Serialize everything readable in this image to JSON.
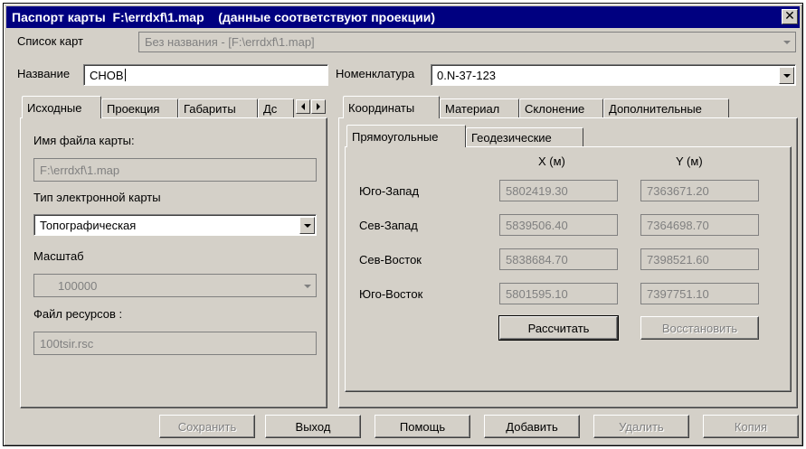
{
  "window": {
    "title": "Паспорт карты  F:\\errdxf\\1.map    (данные соответствуют проекции)",
    "close_glyph": "✕"
  },
  "map_list": {
    "label": "Список карт",
    "value": "Без названия  - [F:\\errdxf\\1.map]"
  },
  "name": {
    "label": "Название",
    "value": "СНОВ"
  },
  "nomenclature": {
    "label": "Номенклатура",
    "value": "0.N-37-123"
  },
  "left_tabs": {
    "items": [
      "Исходные",
      "Проекция",
      "Габариты",
      "Дс"
    ],
    "active": 0
  },
  "source": {
    "filename_label": "Имя файла карты:",
    "filename_value": "F:\\errdxf\\1.map",
    "type_label": "Тип электронной карты",
    "type_value": "Топографическая",
    "scale_label": "Масштаб",
    "scale_value": "100000",
    "resource_label": "Файл ресурсов :",
    "resource_value": "100tsir.rsc"
  },
  "right_tabs": {
    "items": [
      "Координаты",
      "Материал",
      "Склонение",
      "Дополнительные"
    ],
    "active": 0
  },
  "coord_tabs": {
    "items": [
      "Прямоугольные",
      "Геодезические"
    ],
    "active": 0
  },
  "coords": {
    "x_header": "X (м)",
    "y_header": "Y (м)",
    "rows": [
      {
        "label": "Юго-Запад",
        "x": "5802419.30",
        "y": "7363671.20"
      },
      {
        "label": "Сев-Запад",
        "x": "5839506.40",
        "y": "7364698.70"
      },
      {
        "label": "Сев-Восток",
        "x": "5838684.70",
        "y": "7398521.60"
      },
      {
        "label": "Юго-Восток",
        "x": "5801595.10",
        "y": "7397751.10"
      }
    ],
    "calc_button": "Рассчитать",
    "restore_button": "Восстановить"
  },
  "bottom_buttons": {
    "save": "Сохранить",
    "exit": "Выход",
    "help": "Помощь",
    "add": "Добавить",
    "delete": "Удалить",
    "copy": "Копия"
  }
}
